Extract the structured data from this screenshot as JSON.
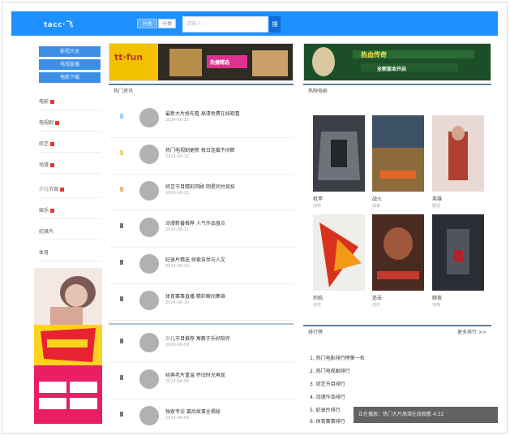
{
  "header": {
    "logo": "tacc·飞",
    "cat_a": "分类",
    "cat_b": "分类",
    "search_placeholder": "请输入",
    "search_button": "搜"
  },
  "sidebar": {
    "buttons": [
      "影视大全",
      "电视直播",
      "电影下载"
    ],
    "items": [
      "电影",
      "电视剧",
      "综艺",
      "动漫",
      "少儿节目",
      "娱乐",
      "纪录片",
      "体育"
    ]
  },
  "banners": {
    "left_title": "tt·fun",
    "left_sub": "热播精选",
    "right_title": "热血传奇",
    "right_sub": "全新版本开启"
  },
  "news": {
    "header": "热门资讯",
    "rows": [
      {
        "title": "最新大片抢先看 高清免费在线观看",
        "meta": "2024-06-12"
      },
      {
        "title": "热门电视剧更新 每日连载不间断",
        "meta": "2024-06-12"
      },
      {
        "title": "综艺节目精彩回顾 明星同台竞技",
        "meta": "2024-06-11"
      },
      {
        "title": "动漫新番推荐 人气作品盘点",
        "meta": "2024-06-11"
      },
      {
        "title": "纪录片精选 探索自然与人文",
        "meta": "2024-06-10"
      },
      {
        "title": "体育赛事直播 精彩瞬间集锦",
        "meta": "2024-06-10"
      },
      {
        "title": "少儿节目推荐 寓教于乐好陪伴",
        "meta": "2024-06-09"
      },
      {
        "title": "经典老片重温 怀旧时光再现",
        "meta": "2024-06-09"
      },
      {
        "title": "独家专访 幕后故事全揭秘",
        "meta": "2024-06-08"
      }
    ]
  },
  "movies": {
    "header": "热映电影",
    "posters": [
      {
        "title": "机甲",
        "sub": "动作"
      },
      {
        "title": "战火",
        "sub": "战争"
      },
      {
        "title": "英雄",
        "sub": "剧情"
      },
      {
        "title": "烈焰",
        "sub": "动作"
      },
      {
        "title": "追击",
        "sub": "动作"
      },
      {
        "title": "暗夜",
        "sub": "惊悚"
      }
    ]
  },
  "ranking": {
    "header": "排行榜",
    "more": "更多排行 >>",
    "items": [
      "1. 热门电影排行榜第一名",
      "2. 热门电视剧排行",
      "3. 综艺节目排行",
      "4. 动漫作品排行",
      "5. 纪录片排行",
      "6. 体育赛事排行"
    ]
  },
  "overlay": "正在播放：热门大片高清在线观看 4:32",
  "colors": {
    "brand": "#1e90ff",
    "hot": "#e53935"
  }
}
